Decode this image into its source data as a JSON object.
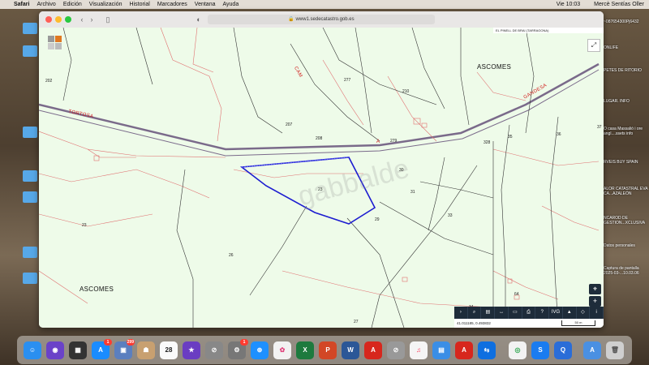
{
  "menubar": {
    "app": "Safari",
    "items": [
      "Archivo",
      "Edición",
      "Visualización",
      "Historial",
      "Marcadores",
      "Ventana",
      "Ayuda"
    ],
    "clock": "Vie 10:03",
    "user": "Mercè Sentías Oller"
  },
  "browser": {
    "url": "www1.sedecatastro.gob.es"
  },
  "map": {
    "header_text": "EL PINELL DE BRAI (TARRAGONA)",
    "watermark": "gabbalde",
    "labels_big": [
      "ASCOMES",
      "ASCOMES"
    ],
    "labels_red": [
      "TORTOSA",
      "GANDESA",
      "CAM",
      "A"
    ],
    "parcel_numbers": [
      "202",
      "277",
      "210",
      "207",
      "208",
      "279",
      "328",
      "35",
      "36",
      "37",
      "30",
      "23",
      "31",
      "33",
      "29",
      "23",
      "26",
      "27",
      "34",
      "64"
    ],
    "coords": "41.011185, 0.493832",
    "scale": "50 m",
    "bottom_tools": [
      "›",
      "⌕",
      "▤",
      "↔",
      "▭",
      "⎙",
      "?",
      "IVG",
      "▲",
      "◇",
      "i"
    ]
  },
  "sidebar_files": [
    "ONLIFE",
    "PETES DE RITORIO",
    "LUGAR. INFO",
    "O casa Massalió i ore angl....ssets info",
    "RVEIS BUY SPAIN",
    "ALOR CATASTRAL EVA CA...AZALEÓN",
    "NCAROD DE GESTION...XCLUSIVA",
    "Datos personales",
    "Captura de pantalla 2025-03-...10.03.06"
  ],
  "sidebar_top": "~087654300Pj6432",
  "dock": [
    {
      "name": "finder",
      "color": "#2a8ff0",
      "label": "☺"
    },
    {
      "name": "siri",
      "color": "#6a42c8",
      "label": "◉"
    },
    {
      "name": "mission-control",
      "color": "#333",
      "label": "▦"
    },
    {
      "name": "app-store",
      "color": "#1a8cff",
      "label": "A",
      "badge": "1"
    },
    {
      "name": "photos-viewer",
      "color": "#5b7fbf",
      "label": "▣",
      "badge": "299"
    },
    {
      "name": "contacts",
      "color": "#c8a070",
      "label": "☗"
    },
    {
      "name": "calendar",
      "color": "#fafafa",
      "label": "28"
    },
    {
      "name": "imovie",
      "color": "#6a3dc2",
      "label": "★"
    },
    {
      "name": "keychain",
      "color": "#888",
      "label": "⊘"
    },
    {
      "name": "system-preferences",
      "color": "#777",
      "label": "⚙",
      "badge": "1"
    },
    {
      "name": "safari",
      "color": "#1e90ff",
      "label": "⊕"
    },
    {
      "name": "photos",
      "color": "#f2f2f2",
      "label": "✿"
    },
    {
      "name": "excel",
      "color": "#1d7a3e",
      "label": "X"
    },
    {
      "name": "powerpoint",
      "color": "#d24726",
      "label": "P"
    },
    {
      "name": "word",
      "color": "#2b5797",
      "label": "W"
    },
    {
      "name": "acrobat",
      "color": "#d7271d",
      "label": "A"
    },
    {
      "name": "preview-blocked",
      "color": "#999",
      "label": "⊘"
    },
    {
      "name": "music",
      "color": "#f5f5f5",
      "label": "♫"
    },
    {
      "name": "pages",
      "color": "#3a8ee6",
      "label": "▤"
    },
    {
      "name": "acrobat-2",
      "color": "#d7271d",
      "label": "A"
    },
    {
      "name": "teamviewer",
      "color": "#0e6fe0",
      "label": "⇆"
    },
    {
      "name": "chrome",
      "color": "#f2f2f2",
      "label": "◎"
    },
    {
      "name": "shazam",
      "color": "#1a7cf0",
      "label": "S"
    },
    {
      "name": "quicktime",
      "color": "#2a6dd8",
      "label": "Q"
    },
    {
      "name": "downloads",
      "color": "#4a90e2",
      "label": "A"
    },
    {
      "name": "trash",
      "color": "#cfcfcf",
      "label": "🗑"
    }
  ],
  "dock_badges": [
    "1",
    "299",
    "1"
  ]
}
